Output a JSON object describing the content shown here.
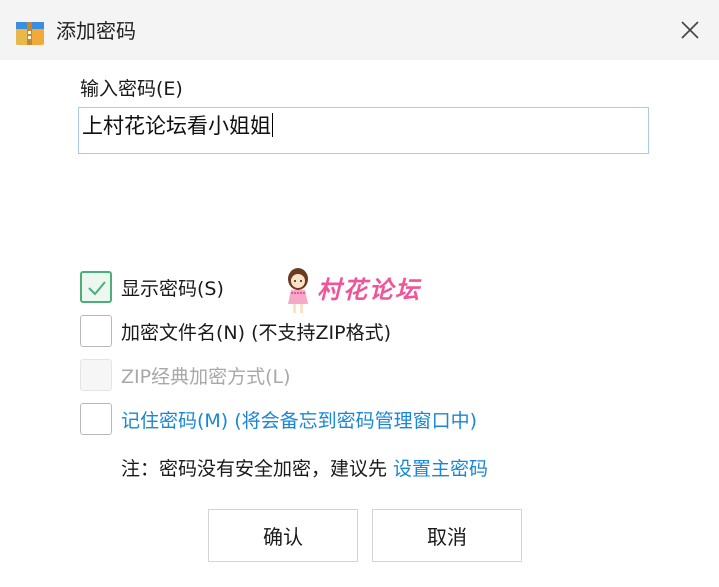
{
  "window": {
    "title": "添加密码",
    "close_icon": "close-icon"
  },
  "password": {
    "label": "输入密码(E)",
    "value": "上村花论坛看小姐姐"
  },
  "options": {
    "show_password": {
      "label": "显示密码(S)",
      "checked": true
    },
    "encrypt_filenames": {
      "label": "加密文件名(N) (不支持ZIP格式)",
      "checked": false
    },
    "zip_legacy": {
      "label": "ZIP经典加密方式(L)",
      "checked": false,
      "enabled": false
    },
    "remember_password": {
      "label": "记住密码(M) (将会备忘到密码管理窗口中)",
      "checked": false
    }
  },
  "note": {
    "text": "注：密码没有安全加密，建议先 ",
    "link": "设置主密码"
  },
  "watermark": {
    "text": "村花论坛"
  },
  "buttons": {
    "ok": "确认",
    "cancel": "取消"
  },
  "colors": {
    "link": "#1a86d8",
    "check": "#4caf7a",
    "input_border": "#a9cbe8",
    "watermark": "#f0559a"
  }
}
